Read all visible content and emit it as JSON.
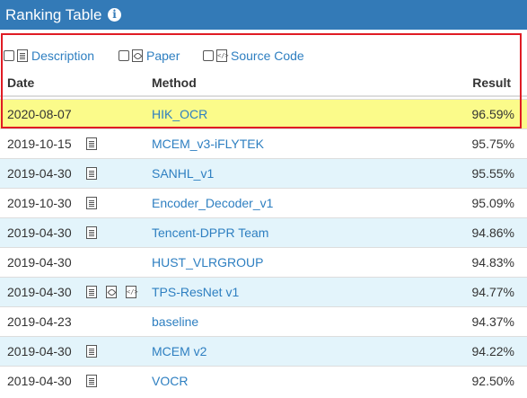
{
  "header": {
    "title": "Ranking Table",
    "info_icon": "info-circle-icon"
  },
  "filters": [
    {
      "label": "Description",
      "icon": "document-icon"
    },
    {
      "label": "Paper",
      "icon": "pdf-icon"
    },
    {
      "label": "Source Code",
      "icon": "code-file-icon"
    }
  ],
  "columns": {
    "date": "Date",
    "method": "Method",
    "result": "Result"
  },
  "rows": [
    {
      "date": "2020-08-07",
      "method": "HIK_OCR",
      "result": "96.59%",
      "icons": []
    },
    {
      "date": "2019-10-15",
      "method": "MCEM_v3-iFLYTEK",
      "result": "95.75%",
      "icons": [
        "doc"
      ]
    },
    {
      "date": "2019-04-30",
      "method": "SANHL_v1",
      "result": "95.55%",
      "icons": [
        "doc"
      ]
    },
    {
      "date": "2019-10-30",
      "method": "Encoder_Decoder_v1",
      "result": "95.09%",
      "icons": [
        "doc"
      ]
    },
    {
      "date": "2019-04-30",
      "method": "Tencent-DPPR Team",
      "result": "94.86%",
      "icons": [
        "doc"
      ]
    },
    {
      "date": "2019-04-30",
      "method": "HUST_VLRGROUP",
      "result": "94.83%",
      "icons": []
    },
    {
      "date": "2019-04-30",
      "method": "TPS-ResNet v1",
      "result": "94.77%",
      "icons": [
        "doc",
        "pdf",
        "code"
      ]
    },
    {
      "date": "2019-04-23",
      "method": "baseline",
      "result": "94.37%",
      "icons": []
    },
    {
      "date": "2019-04-30",
      "method": "MCEM v2",
      "result": "94.22%",
      "icons": [
        "doc"
      ]
    },
    {
      "date": "2019-04-30",
      "method": "VOCR",
      "result": "92.50%",
      "icons": [
        "doc"
      ]
    }
  ],
  "colors": {
    "header": "#337ab7",
    "link": "#2e7fc1",
    "highlight": "#fbfb8a",
    "stripe": "#e3f4fb",
    "selection_border": "#e01b24"
  }
}
